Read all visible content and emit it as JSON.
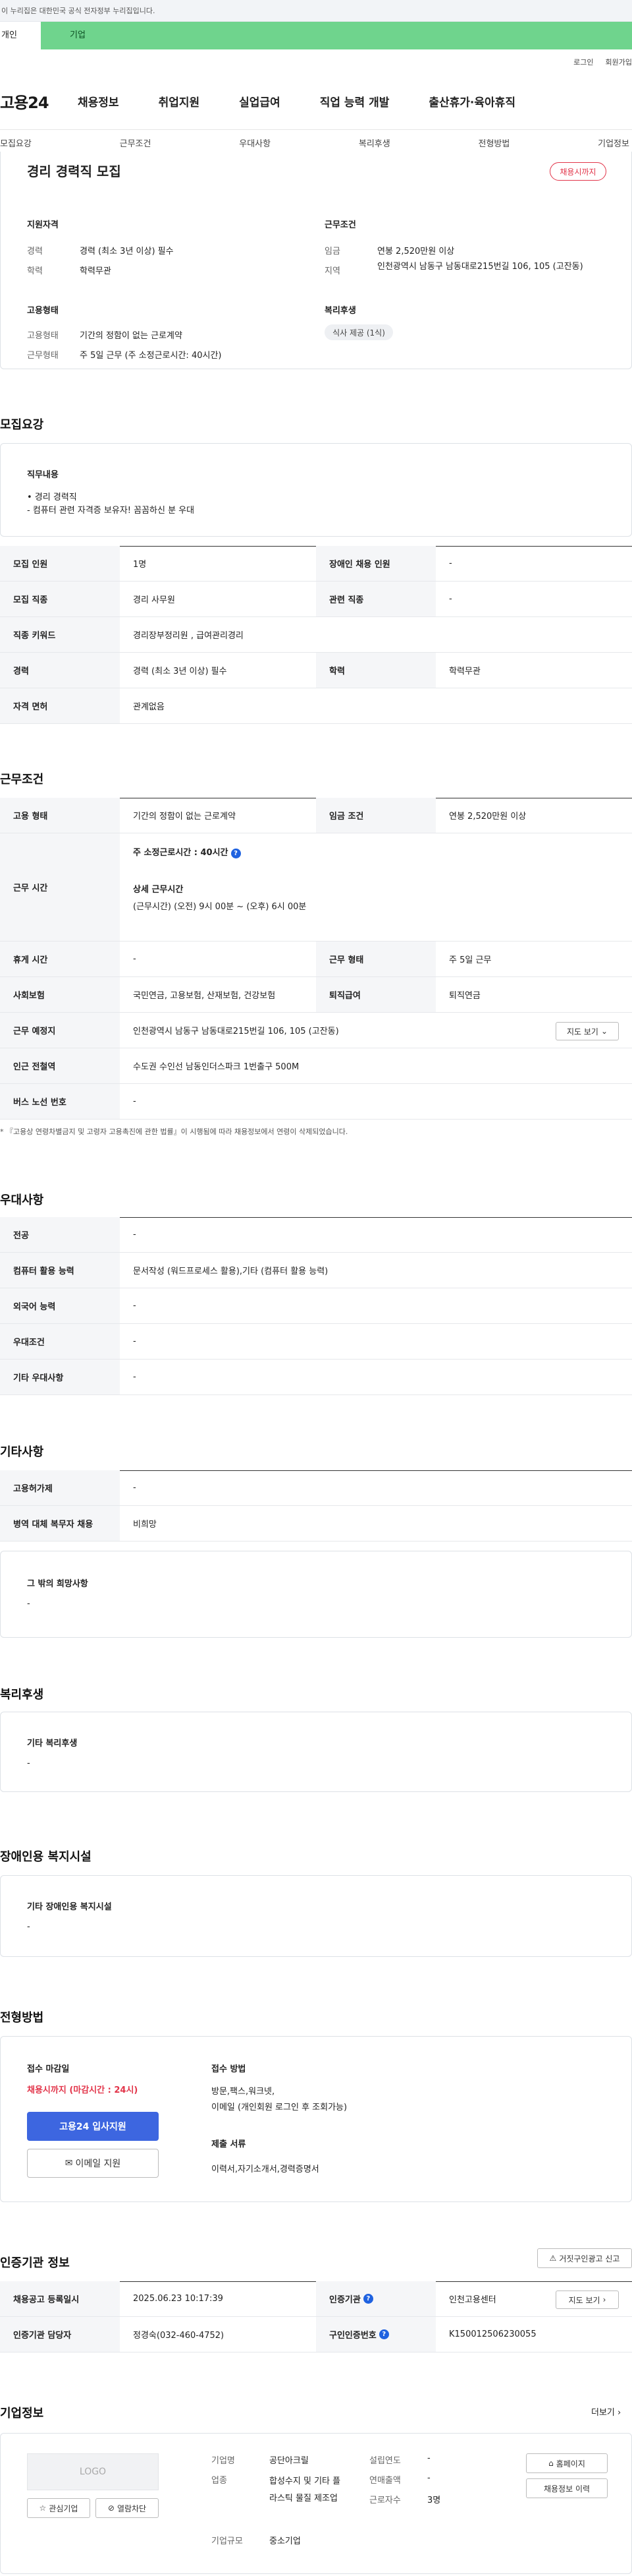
{
  "notice": "이 누리집은 대한민국 공식 전자정부 누리집입니다.",
  "segments": {
    "person": "개인",
    "company": "기업"
  },
  "util": {
    "login": "로그인",
    "join": "회원가입"
  },
  "gnb": {
    "logo": "고용24",
    "menu": [
      "채용정보",
      "취업지원",
      "실업급여",
      "직업 능력 개발",
      "출산휴가·육아휴직"
    ]
  },
  "subnav": [
    "모집요강",
    "근무조건",
    "우대사항",
    "복리후생",
    "전형방법",
    "기업정보"
  ],
  "summary": {
    "title": "경리 경력직 모집",
    "badge": "채용시까지",
    "qual_title": "지원자격",
    "qual": [
      {
        "k": "경력",
        "v": "경력 (최소 3년 이상) 필수"
      },
      {
        "k": "학력",
        "v": "학력무관"
      }
    ],
    "cond_title": "근무조건",
    "cond": [
      {
        "k": "임금",
        "v": "연봉 2,520만원 이상"
      },
      {
        "k": "지역",
        "v": "인천광역시 남동구 남동대로215번길 106, 105 (고잔동)"
      }
    ],
    "emp_title": "고용형태",
    "emp": [
      {
        "k": "고용형태",
        "v": "기간의 정함이 없는 근로계약"
      },
      {
        "k": "근무형태",
        "v": "주 5일 근무 (주 소정근로시간: 40시간)"
      }
    ],
    "welfare_title": "복리후생",
    "welfare_chip": "식사 제공 (1식)"
  },
  "recruit": {
    "heading": "모집요강",
    "duty_title": "직무내용",
    "duty_lines": [
      "• 경리 경력직",
      "- 컴퓨터 관련 자격증 보유자! 꼼꼼하신 분 우대"
    ],
    "rows": [
      {
        "th": "모집 인원",
        "td": "1명",
        "th2": "장애인 채용 인원",
        "td2": "-"
      },
      {
        "th": "모집 직종",
        "td": "경리 사무원",
        "th2": "관련 직종",
        "td2": "-"
      },
      {
        "th": "직종 키워드",
        "td": "경리장부정리원 , 급여관리경리"
      },
      {
        "th": "경력",
        "td": "경력 (최소 3년 이상) 필수",
        "th2": "학력",
        "td2": "학력무관"
      },
      {
        "th": "자격 면허",
        "td": "관계없음"
      }
    ]
  },
  "work": {
    "heading": "근무조건",
    "r1": {
      "th": "고용 형태",
      "td": "기간의 정함이 없는 근로계약",
      "th2": "임금 조건",
      "td2": "연봉 2,520만원 이상"
    },
    "r2": {
      "th": "근무 시간",
      "weekly": "주 소정근로시간 : 40시간",
      "detail_title": "상세 근무시간",
      "detail": "(근무시간) (오전) 9시 00분 ~ (오후) 6시 00분"
    },
    "r3": {
      "th": "휴게 시간",
      "td": "-",
      "th2": "근무 형태",
      "td2": "주 5일 근무"
    },
    "r4": {
      "th": "사회보험",
      "td": "국민연금, 고용보험, 산재보험, 건강보험",
      "th2": "퇴직급여",
      "td2": "퇴직연금"
    },
    "r5": {
      "th": "근무 예정지",
      "td": "인천광역시 남동구 남동대로215번길 106, 105 (고잔동)",
      "btn": "지도 보기"
    },
    "r6": {
      "th": "인근 전철역",
      "td": "수도권 수인선 남동인더스파크 1번출구 500M"
    },
    "r7": {
      "th": "버스 노선 번호",
      "td": "-"
    },
    "note": "* 『고용상 연령차별금지 및 고령자 고용촉진에 관한 법률』이 시행됨에 따라 채용정보에서 연령이 삭제되었습니다."
  },
  "pref": {
    "heading": "우대사항",
    "rows": [
      {
        "th": "전공",
        "td": "-"
      },
      {
        "th": "컴퓨터 활용 능력",
        "td": "문서작성 (워드프로세스 활용),기타 (컴퓨터 활용 능력)"
      },
      {
        "th": "외국어 능력",
        "td": "-"
      },
      {
        "th": "우대조건",
        "td": "-"
      },
      {
        "th": "기타 우대사항",
        "td": "-"
      }
    ]
  },
  "etc": {
    "heading": "기타사항",
    "rows": [
      {
        "th": "고용허가제",
        "td": "-"
      },
      {
        "th": "병역 대체 복무자 채용",
        "td": "비희망"
      }
    ],
    "box_title": "그 밖의 희망사항",
    "box_val": "-"
  },
  "welfare": {
    "heading": "복리후생",
    "box_title": "기타 복리후생",
    "box_val": "-"
  },
  "disabled": {
    "heading": "장애인용 복지시설",
    "box_title": "기타 장애인용 복지시설",
    "box_val": "-"
  },
  "selection": {
    "heading": "전형방법",
    "deadline_title": "접수 마감일",
    "deadline": "채용시까지 (마감시간 : 24시)",
    "apply_btn": "고용24 입사지원",
    "email_btn": "이메일 지원",
    "method_title": "접수 방법",
    "method": [
      "방문,팩스,워크넷,",
      "이메일 (개인회원 로그인 후 조회가능)"
    ],
    "docs_title": "제출 서류",
    "docs": "이력서,자기소개서,경력증명서"
  },
  "agency": {
    "heading": "인증기관 정보",
    "report_btn": "거짓구인광고 신고",
    "r1": {
      "th": "채용공고 등록일시",
      "td": "2025.06.23 10:17:39",
      "th2": "인증기관",
      "td2": "인천고용센터",
      "btn": "지도 보기"
    },
    "r2": {
      "th": "인증기관 담당자",
      "td": "정경숙(032-460-4752)",
      "th2": "구인인증번호",
      "td2": "K150012506230055"
    }
  },
  "company": {
    "heading": "기업정보",
    "more": "더보기",
    "logo": "LOGO",
    "fav_btn": "관심기업",
    "block_btn": "열람차단",
    "fields": [
      {
        "k": "기업명",
        "v": "공단아크릴"
      },
      {
        "k": "업종",
        "v": "합성수지 및 기타 플라스틱 물질 제조업"
      },
      {
        "k": "기업규모",
        "v": "중소기업"
      }
    ],
    "fields2": [
      {
        "k": "설립연도",
        "v": "-"
      },
      {
        "k": "연매출액",
        "v": "-"
      },
      {
        "k": "근로자수",
        "v": "3명"
      }
    ],
    "home_btn": "홈페이지",
    "history_btn": "채용정보 이력"
  }
}
